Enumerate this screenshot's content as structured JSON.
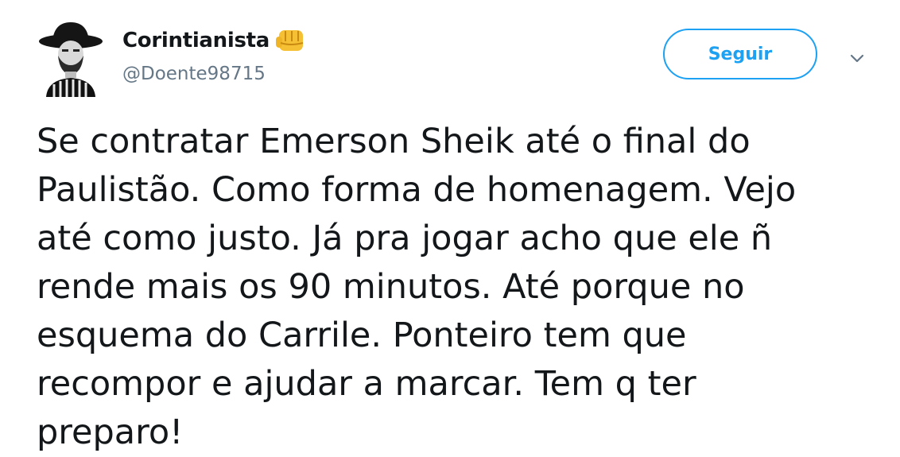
{
  "author": {
    "display_name": "Corintianista",
    "name_emoji": "fist-emoji-icon",
    "handle": "@Doente98715",
    "avatar": "avatar-image"
  },
  "actions": {
    "follow_label": "Seguir",
    "menu_icon": "chevron-down-icon"
  },
  "tweet": {
    "lines": [
      "Se contratar Emerson Sheik até o final do",
      "Paulistão. Como forma de homenagem. Vejo",
      "até como justo. Já pra jogar acho que ele ñ",
      "rende mais os 90 minutos. Até porque no",
      "esquema do Carrile. Ponteiro tem que",
      "recompor e ajudar a marcar. Tem q ter",
      "preparo!"
    ]
  },
  "colors": {
    "accent": "#1da1f2",
    "text": "#14171a",
    "secondary_text": "#657786",
    "emoji": "#f5c033"
  }
}
